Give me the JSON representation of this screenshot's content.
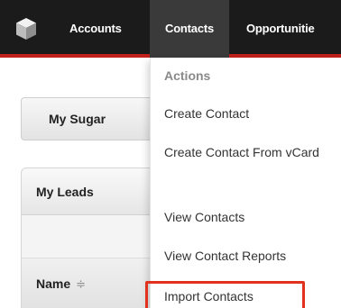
{
  "nav": {
    "logo_icon": "sugar-cube-icon",
    "tabs": [
      {
        "label": "Accounts"
      },
      {
        "label": "Contacts"
      },
      {
        "label": "Opportunitie"
      }
    ]
  },
  "main": {
    "my_sugar_tab": "My Sugar",
    "dashlet": {
      "title": "My Leads",
      "column_header": "Name",
      "sort_icon": "≑"
    }
  },
  "dropdown": {
    "heading": "Actions",
    "items": [
      {
        "label": "Create Contact"
      },
      {
        "label": "Create Contact From vCard"
      },
      {
        "label": "View Contacts"
      },
      {
        "label": "View Contact Reports"
      },
      {
        "label": "Import Contacts"
      }
    ],
    "highlighted_item": "Import Contacts"
  },
  "colors": {
    "nav_bg": "#1b1b1b",
    "nav_accent": "#c1201b",
    "highlight": "#e0321f"
  }
}
